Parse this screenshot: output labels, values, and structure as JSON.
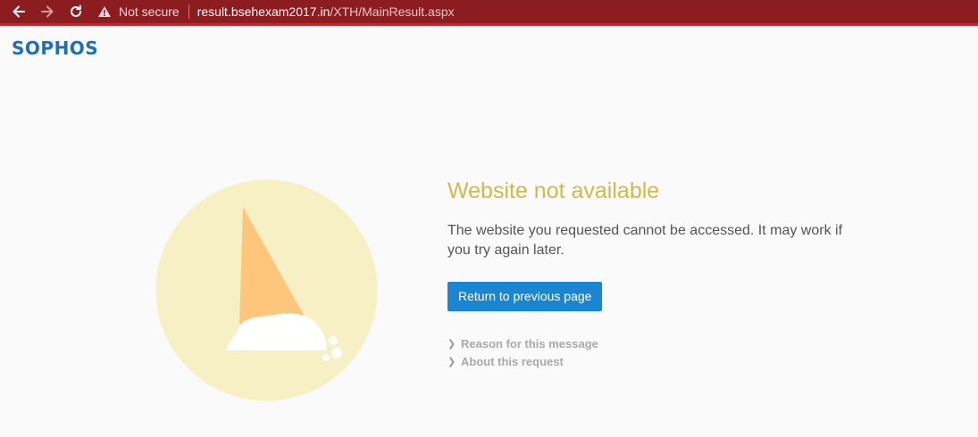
{
  "browser": {
    "not_secure": "Not secure",
    "url_host": "result.bsehexam2017.in",
    "url_path": "/XTH/MainResult.aspx",
    "bar_color": "#8b1c1f"
  },
  "brand": {
    "logo_text": "SOPHOS",
    "logo_color": "#1e6fb7"
  },
  "error": {
    "title": "Website not available",
    "description": "The website you requested cannot be accessed. It may work if you try again later.",
    "return_button": "Return to previous page",
    "links": [
      {
        "label": "Reason for this message"
      },
      {
        "label": "About this request"
      }
    ],
    "title_color": "#d2b948",
    "button_color": "#1a86d2"
  },
  "illustration": {
    "icon": "dropped-ice-cream-icon",
    "circle_color": "#f6f0c4",
    "cone_color": "#fdc67a",
    "scoop_color": "#ffffff"
  }
}
